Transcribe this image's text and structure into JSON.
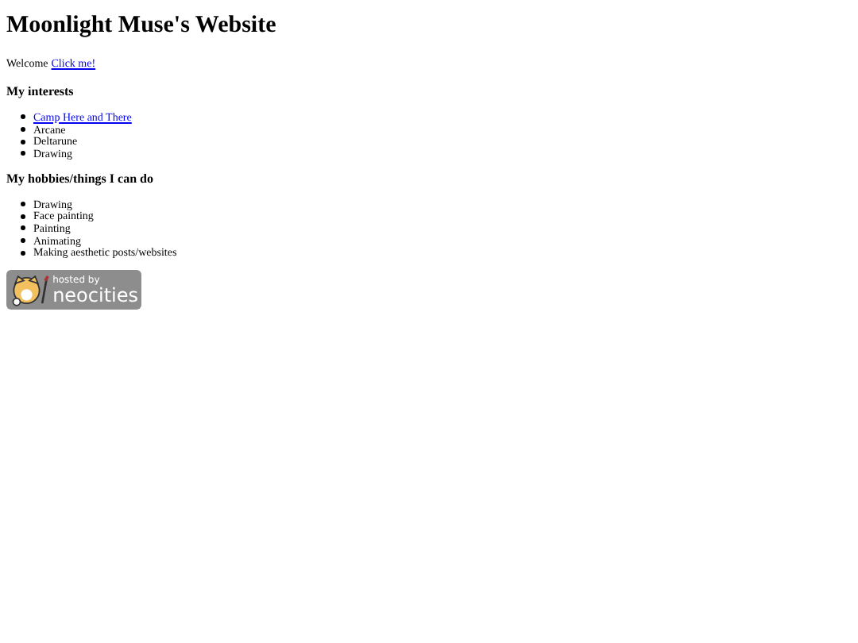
{
  "title": "Moonlight Muse's Website",
  "welcome": {
    "text": "Welcome",
    "link": "Click me!"
  },
  "sections": [
    {
      "heading": "My interests",
      "items": [
        {
          "text": "Camp Here and There",
          "kind": "link"
        },
        {
          "text": "Arcane",
          "kind": "text"
        },
        {
          "text": "Deltarune",
          "kind": "text"
        },
        {
          "text": "Drawing",
          "kind": "text"
        }
      ]
    },
    {
      "heading": "My hobbies/things I can do",
      "items": [
        {
          "text": "Drawing",
          "kind": "text"
        },
        {
          "text": "Face painting",
          "kind": "text"
        },
        {
          "text": "Painting",
          "kind": "text"
        },
        {
          "text": "Animating",
          "kind": "text"
        },
        {
          "text": "Making aesthetic posts/websites",
          "kind": "text"
        }
      ]
    }
  ],
  "badge": {
    "line_1": "hosted by",
    "line_2": "neocities"
  }
}
